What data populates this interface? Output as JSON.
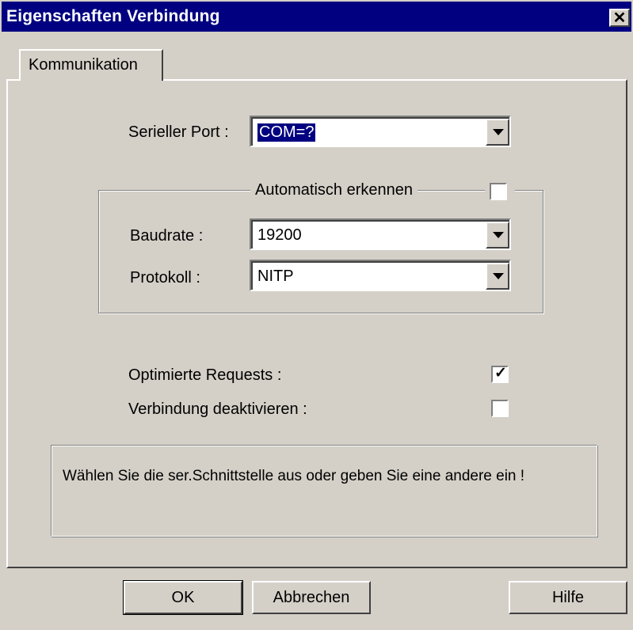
{
  "window": {
    "title": "Eigenschaften Verbindung",
    "close_glyph": "✕"
  },
  "tab": {
    "label": "Kommunikation"
  },
  "serial_port": {
    "label": "Serieller Port :",
    "value": "COM=?"
  },
  "auto_detect": {
    "label": "Automatisch erkennen",
    "checked": false
  },
  "baudrate": {
    "label": "Baudrate :",
    "value": "19200"
  },
  "protocol": {
    "label": "Protokoll :",
    "value": "NITP"
  },
  "optimized_requests": {
    "label": "Optimierte Requests :",
    "checked": true,
    "mark": "✓"
  },
  "deactivate_connection": {
    "label": "Verbindung deaktivieren :",
    "checked": false,
    "mark": ""
  },
  "info": {
    "text": "Wählen Sie die ser.Schnittstelle aus oder geben Sie eine andere ein !"
  },
  "buttons": {
    "ok": "OK",
    "cancel": "Abbrechen",
    "help": "Hilfe"
  },
  "colors": {
    "title_bar": "#000080",
    "face": "#d4d0c8",
    "selection": "#000080"
  }
}
